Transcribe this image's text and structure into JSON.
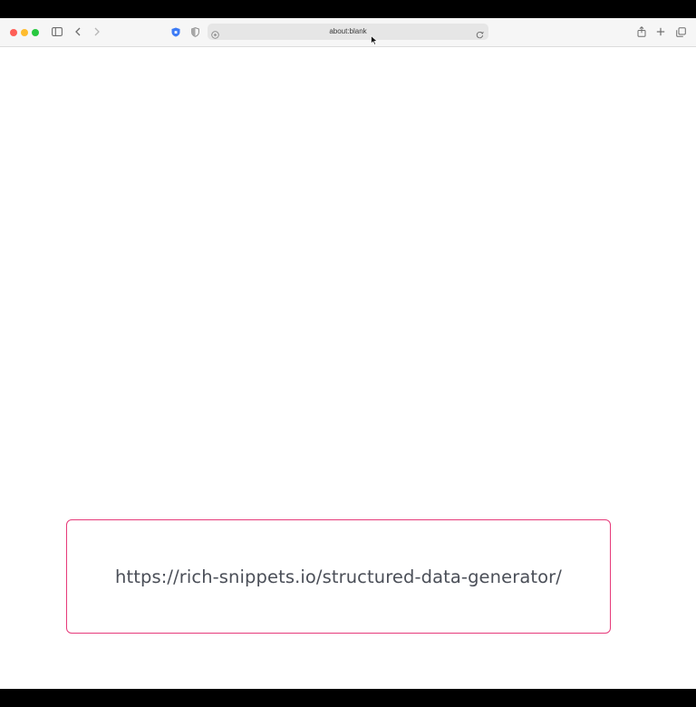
{
  "browser": {
    "address_bar": {
      "url": "about:blank"
    },
    "icons": {
      "sidebar": "sidebar-icon",
      "back": "chevron-left-icon",
      "forward": "chevron-right-icon",
      "extension": "shield-extension-icon",
      "privacy": "privacy-report-icon",
      "site_info": "site-info-icon",
      "reload": "reload-icon",
      "share": "share-icon",
      "new_tab": "plus-icon",
      "tab_overview": "tab-overview-icon"
    },
    "colors": {
      "close": "#fe5f57",
      "minimize": "#febc2e",
      "zoom": "#28c840"
    }
  },
  "overlay": {
    "url_caption": "https://rich-snippets.io/structured-data-generator/",
    "border_color": "#e63a7a"
  }
}
